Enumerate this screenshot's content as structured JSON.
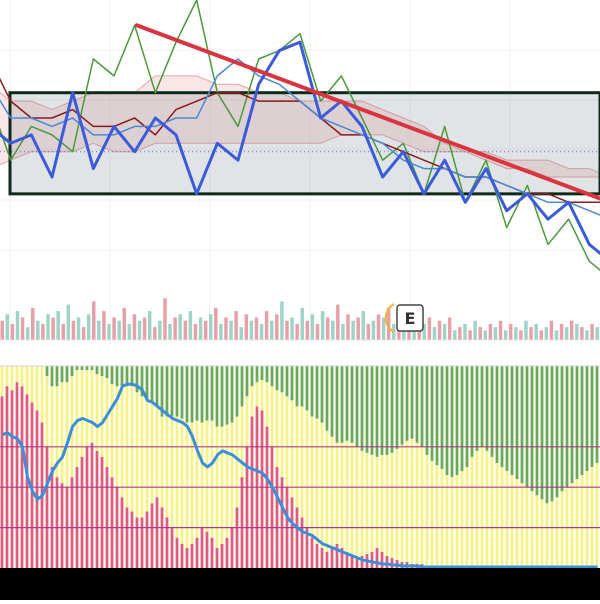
{
  "chart_data": [
    {
      "type": "line",
      "panel": "price",
      "x": [
        0,
        1,
        2,
        3,
        4,
        5,
        6,
        7,
        8,
        9,
        10,
        11,
        12,
        13,
        14,
        15,
        16,
        17,
        18,
        19,
        20,
        21,
        22,
        23,
        24,
        25,
        26,
        27,
        28,
        29,
        30
      ],
      "series": [
        {
          "role": "price-line",
          "color": "#3b5bdb",
          "values": [
            100,
            98,
            99,
            94,
            104,
            95,
            100,
            97,
            101,
            99,
            92,
            98,
            96,
            105,
            109,
            110,
            101,
            103,
            100,
            94,
            97,
            92,
            96,
            91,
            95,
            90,
            92,
            89,
            91,
            86,
            84
          ]
        },
        {
          "role": "lagging-span",
          "color": "#4a9a3a",
          "values": [
            103,
            96,
            100,
            99,
            97,
            108,
            106,
            112,
            104,
            110,
            115,
            104,
            100,
            108,
            109,
            111,
            103,
            106,
            101,
            96,
            98,
            92,
            100,
            91,
            96,
            88,
            93,
            86,
            89,
            84,
            82
          ]
        },
        {
          "role": "base-line",
          "color": "#8b1a1a",
          "values": [
            108,
            103,
            101,
            101,
            102,
            100,
            100,
            101,
            99,
            102,
            103,
            104,
            104,
            103,
            103,
            103,
            101,
            99,
            99,
            98,
            97,
            96,
            95,
            94,
            94,
            93,
            92,
            92,
            91,
            91,
            91
          ]
        },
        {
          "role": "conversion-line",
          "color": "#4c8ad6",
          "values": [
            105,
            101,
            101,
            100,
            101,
            99,
            99,
            100,
            100,
            101,
            101,
            106,
            108,
            106,
            105,
            103,
            101,
            100,
            99,
            98,
            96,
            95,
            95,
            94,
            94,
            93,
            92,
            91,
            91,
            90,
            89
          ]
        }
      ],
      "cloud": {
        "upper": [
          105,
          103,
          103,
          102,
          103,
          104,
          104,
          104,
          106,
          106,
          106,
          105,
          105,
          104,
          104,
          103,
          103,
          103,
          103,
          102,
          101,
          100,
          98,
          97,
          97,
          96,
          96,
          96,
          95,
          95,
          94
        ],
        "lower": [
          95,
          96,
          97,
          97,
          97,
          98,
          97,
          97,
          98,
          98,
          98,
          98,
          98,
          98,
          98,
          98,
          98,
          99,
          99,
          99,
          98,
          97,
          97,
          97,
          96,
          95,
          95,
          94,
          94,
          94,
          94
        ]
      },
      "range_box": {
        "high": 104,
        "low": 92
      },
      "trendline": {
        "from": [
          7.1,
          112
        ],
        "to": [
          30,
          91
        ],
        "color": "#d9343f"
      },
      "reference_line": 97,
      "ylim": [
        80,
        115
      ],
      "grid": true,
      "marker_label": "E"
    },
    {
      "type": "bar",
      "panel": "volume",
      "values": [
        6,
        8,
        5,
        9,
        7,
        4,
        10,
        6,
        5,
        8,
        7,
        9,
        5,
        11,
        6,
        7,
        4,
        8,
        12,
        6,
        9,
        5,
        7,
        6,
        10,
        5,
        8,
        6,
        7,
        9,
        4,
        6,
        13,
        5,
        7,
        8,
        6,
        9,
        5,
        7,
        6,
        8,
        10,
        5,
        7,
        6,
        9,
        4,
        8,
        6,
        7,
        5,
        9,
        6,
        8,
        12,
        6,
        7,
        5,
        10,
        6,
        8,
        5,
        9,
        7,
        6,
        11,
        5,
        8,
        6,
        7,
        9,
        5,
        6,
        8,
        7,
        10,
        5,
        6,
        9,
        7,
        8,
        6,
        5,
        7,
        4,
        6,
        5,
        7,
        3,
        4,
        5,
        3,
        6,
        4,
        3,
        5,
        4,
        6,
        3,
        5,
        4,
        3,
        6,
        4,
        5,
        3,
        4,
        6,
        3,
        5,
        4,
        6,
        5,
        4,
        3,
        5,
        4
      ],
      "colors": [
        "#e8a0a8",
        "#9fd3c7"
      ],
      "ylim": [
        0,
        14
      ]
    },
    {
      "type": "bar",
      "panel": "oscillator",
      "categories_count": 120,
      "series": [
        {
          "name": "",
          "color": "#e05d7a",
          "values": [
            0.85,
            0.9,
            0.88,
            0.92,
            0.9,
            0.86,
            0.82,
            0.78,
            0.72,
            0.6,
            0.5,
            0.45,
            0.42,
            0.4,
            0.45,
            0.5,
            0.55,
            0.6,
            0.62,
            0.58,
            0.55,
            0.5,
            0.45,
            0.4,
            0.35,
            0.3,
            0.28,
            0.25,
            0.25,
            0.28,
            0.32,
            0.35,
            0.3,
            0.25,
            0.2,
            0.15,
            0.12,
            0.1,
            0.12,
            0.15,
            0.2,
            0.18,
            0.15,
            0.1,
            0.12,
            0.15,
            0.2,
            0.3,
            0.45,
            0.6,
            0.75,
            0.8,
            0.78,
            0.7,
            0.6,
            0.5,
            0.45,
            0.4,
            0.35,
            0.3,
            0.25,
            0.2,
            0.15,
            0.12,
            0.1,
            0.08,
            0.1,
            0.12,
            0.1,
            0.08,
            0.06,
            0.05,
            0.06,
            0.07,
            0.08,
            0.1,
            0.08,
            0.06,
            0.05,
            0.04,
            0.03,
            0.03,
            0.02,
            0.02,
            0.02,
            0.01,
            0.01,
            0.01,
            0.01,
            0.01,
            0.01,
            0.01,
            0,
            0,
            0,
            0,
            0,
            0,
            0,
            0,
            0,
            0,
            0,
            0,
            0,
            0,
            0,
            0,
            0,
            0,
            0,
            0,
            0,
            0,
            0,
            0,
            0,
            0,
            0,
            0
          ]
        },
        {
          "name": "",
          "color": "#f6f283",
          "values": [
            0.15,
            0.1,
            0.12,
            0.08,
            0.1,
            0.14,
            0.18,
            0.22,
            0.28,
            0.35,
            0.4,
            0.45,
            0.5,
            0.52,
            0.5,
            0.48,
            0.43,
            0.38,
            0.36,
            0.38,
            0.4,
            0.44,
            0.46,
            0.5,
            0.55,
            0.6,
            0.62,
            0.62,
            0.6,
            0.55,
            0.5,
            0.45,
            0.45,
            0.5,
            0.55,
            0.6,
            0.62,
            0.62,
            0.6,
            0.58,
            0.52,
            0.55,
            0.58,
            0.6,
            0.58,
            0.56,
            0.52,
            0.45,
            0.35,
            0.25,
            0.15,
            0.12,
            0.15,
            0.22,
            0.3,
            0.38,
            0.42,
            0.45,
            0.48,
            0.5,
            0.55,
            0.58,
            0.6,
            0.62,
            0.62,
            0.6,
            0.55,
            0.5,
            0.52,
            0.55,
            0.56,
            0.55,
            0.52,
            0.5,
            0.48,
            0.45,
            0.48,
            0.5,
            0.52,
            0.55,
            0.58,
            0.6,
            0.62,
            0.6,
            0.58,
            0.55,
            0.52,
            0.5,
            0.48,
            0.45,
            0.44,
            0.45,
            0.48,
            0.5,
            0.55,
            0.58,
            0.6,
            0.58,
            0.55,
            0.52,
            0.5,
            0.48,
            0.46,
            0.44,
            0.42,
            0.4,
            0.38,
            0.36,
            0.34,
            0.32,
            0.33,
            0.35,
            0.38,
            0.4,
            0.42,
            0.44,
            0.46,
            0.48,
            0.5,
            0.52
          ]
        },
        {
          "name": "",
          "color": "#6aaa52",
          "values": [
            0,
            0,
            0,
            0,
            0,
            0,
            0,
            0,
            0,
            0.05,
            0.1,
            0.1,
            0.08,
            0.08,
            0.05,
            0.02,
            0.02,
            0.02,
            0.02,
            0.04,
            0.05,
            0.06,
            0.09,
            0.1,
            0.1,
            0.1,
            0.1,
            0.13,
            0.15,
            0.17,
            0.18,
            0.2,
            0.25,
            0.25,
            0.25,
            0.25,
            0.26,
            0.28,
            0.28,
            0.27,
            0.28,
            0.27,
            0.27,
            0.3,
            0.3,
            0.29,
            0.28,
            0.25,
            0.2,
            0.15,
            0.1,
            0.08,
            0.07,
            0.08,
            0.1,
            0.12,
            0.13,
            0.15,
            0.17,
            0.2,
            0.2,
            0.22,
            0.25,
            0.26,
            0.28,
            0.32,
            0.35,
            0.38,
            0.38,
            0.37,
            0.38,
            0.4,
            0.42,
            0.43,
            0.44,
            0.45,
            0.44,
            0.44,
            0.43,
            0.41,
            0.39,
            0.37,
            0.36,
            0.38,
            0.4,
            0.44,
            0.47,
            0.49,
            0.51,
            0.54,
            0.55,
            0.54,
            0.52,
            0.5,
            0.45,
            0.42,
            0.4,
            0.42,
            0.45,
            0.48,
            0.5,
            0.52,
            0.54,
            0.56,
            0.58,
            0.6,
            0.62,
            0.64,
            0.66,
            0.68,
            0.67,
            0.65,
            0.62,
            0.6,
            0.58,
            0.56,
            0.54,
            0.52,
            0.5,
            0.48
          ]
        }
      ],
      "line": {
        "color": "#3a8fd8",
        "values": [
          0.34,
          0.33,
          0.35,
          0.36,
          0.4,
          0.55,
          0.62,
          0.66,
          0.64,
          0.58,
          0.52,
          0.48,
          0.45,
          0.38,
          0.3,
          0.27,
          0.26,
          0.27,
          0.28,
          0.3,
          0.28,
          0.24,
          0.2,
          0.16,
          0.1,
          0.09,
          0.09,
          0.1,
          0.12,
          0.17,
          0.18,
          0.2,
          0.22,
          0.24,
          0.26,
          0.27,
          0.28,
          0.3,
          0.35,
          0.42,
          0.48,
          0.5,
          0.48,
          0.44,
          0.42,
          0.43,
          0.44,
          0.46,
          0.48,
          0.5,
          0.51,
          0.52,
          0.53,
          0.56,
          0.6,
          0.65,
          0.7,
          0.75,
          0.78,
          0.8,
          0.82,
          0.83,
          0.84,
          0.86,
          0.88,
          0.89,
          0.9,
          0.91,
          0.92,
          0.93,
          0.94,
          0.95,
          0.96,
          0.965,
          0.97,
          0.975,
          0.98,
          0.98,
          0.985,
          0.985,
          0.99,
          0.99,
          0.99,
          0.99,
          0.995,
          0.995,
          0.995,
          0.995,
          0.995,
          0.995,
          0.995,
          0.995,
          0.995,
          0.995,
          0.995,
          0.995,
          0.995,
          0.995,
          0.995,
          0.995,
          0.995,
          0.995,
          0.995,
          0.995,
          0.995,
          0.995,
          0.995,
          0.995,
          0.995,
          0.995,
          0.995,
          0.995,
          0.995,
          0.995,
          0.995,
          0.995,
          0.995,
          0.995,
          0.995,
          0.995
        ]
      },
      "reference_lines": [
        0.2,
        0.4,
        0.6
      ],
      "ylim": [
        0,
        1
      ]
    }
  ]
}
